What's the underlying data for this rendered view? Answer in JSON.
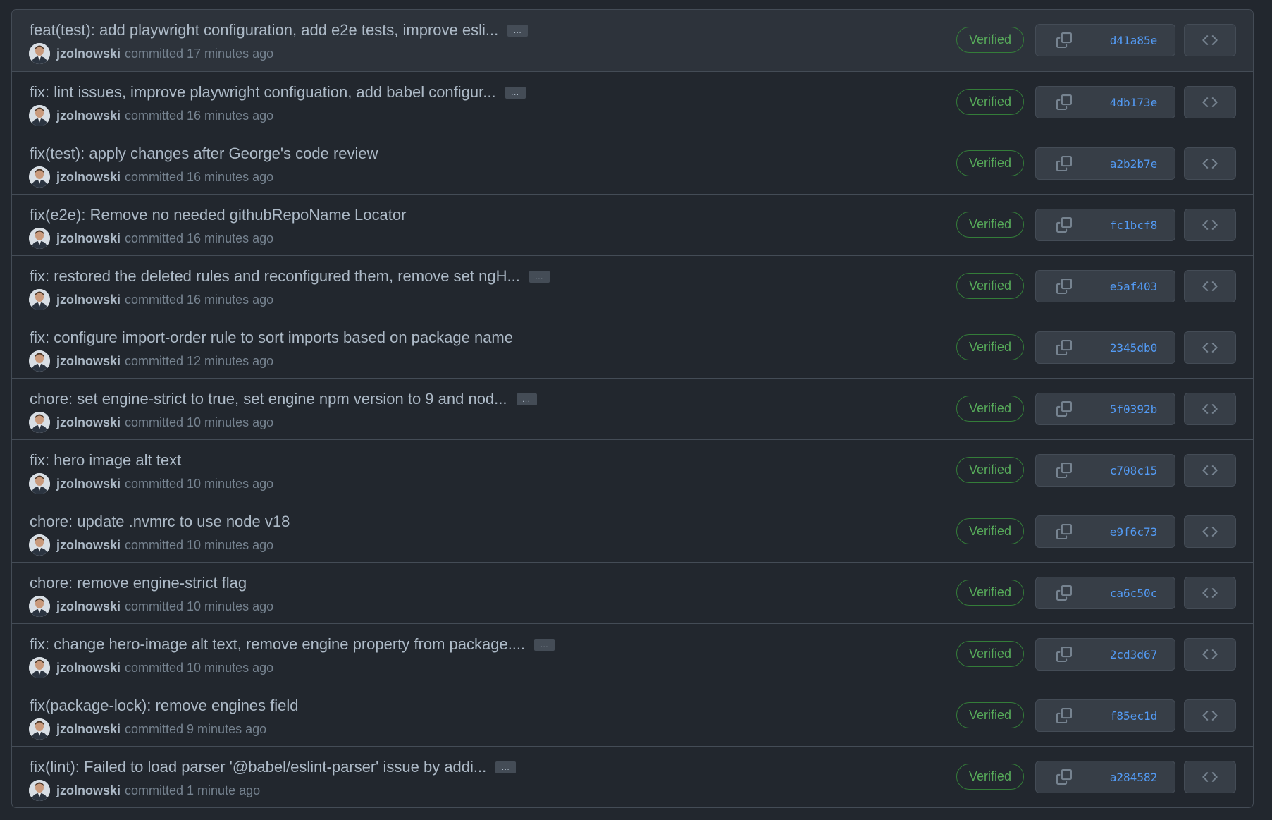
{
  "ellipsis_label": "…",
  "verified_label": "Verified",
  "commits": [
    {
      "message": "feat(test): add playwright configuration, add e2e tests, improve esli...",
      "truncated": true,
      "author": "jzolnowski",
      "time": "committed 17 minutes ago",
      "sha": "d41a85e"
    },
    {
      "message": "fix: lint issues, improve playwright configuation, add babel configur...",
      "truncated": true,
      "author": "jzolnowski",
      "time": "committed 16 minutes ago",
      "sha": "4db173e"
    },
    {
      "message": "fix(test): apply changes after George's code review",
      "truncated": false,
      "author": "jzolnowski",
      "time": "committed 16 minutes ago",
      "sha": "a2b2b7e"
    },
    {
      "message": "fix(e2e): Remove no needed githubRepoName Locator",
      "truncated": false,
      "author": "jzolnowski",
      "time": "committed 16 minutes ago",
      "sha": "fc1bcf8"
    },
    {
      "message": "fix: restored the deleted rules and reconfigured them, remove set ngH...",
      "truncated": true,
      "author": "jzolnowski",
      "time": "committed 16 minutes ago",
      "sha": "e5af403"
    },
    {
      "message": "fix: configure import-order rule to sort imports based on package name",
      "truncated": false,
      "author": "jzolnowski",
      "time": "committed 12 minutes ago",
      "sha": "2345db0"
    },
    {
      "message": "chore: set engine-strict to true, set engine npm version to 9 and nod...",
      "truncated": true,
      "author": "jzolnowski",
      "time": "committed 10 minutes ago",
      "sha": "5f0392b"
    },
    {
      "message": "fix: hero image alt text",
      "truncated": false,
      "author": "jzolnowski",
      "time": "committed 10 minutes ago",
      "sha": "c708c15"
    },
    {
      "message": "chore: update .nvmrc to use node v18",
      "truncated": false,
      "author": "jzolnowski",
      "time": "committed 10 minutes ago",
      "sha": "e9f6c73"
    },
    {
      "message": "chore: remove engine-strict flag",
      "truncated": false,
      "author": "jzolnowski",
      "time": "committed 10 minutes ago",
      "sha": "ca6c50c"
    },
    {
      "message": "fix: change hero-image alt text, remove engine property from package....",
      "truncated": true,
      "author": "jzolnowski",
      "time": "committed 10 minutes ago",
      "sha": "2cd3d67"
    },
    {
      "message": "fix(package-lock): remove engines field",
      "truncated": false,
      "author": "jzolnowski",
      "time": "committed 9 minutes ago",
      "sha": "f85ec1d"
    },
    {
      "message": "fix(lint): Failed to load parser '@babel/eslint-parser' issue by addi...",
      "truncated": true,
      "author": "jzolnowski",
      "time": "committed 1 minute ago",
      "sha": "a284582"
    }
  ],
  "colors": {
    "background": "#22272e",
    "first_row_background": "#2d333b",
    "border": "#444c56",
    "text": "#adbac7",
    "muted": "#768390",
    "verified_green": "#57ab5a",
    "sha_blue": "#539bf5"
  },
  "icons": {
    "avatar": "avatar",
    "copy": "copy-icon",
    "browse": "code-icon"
  }
}
